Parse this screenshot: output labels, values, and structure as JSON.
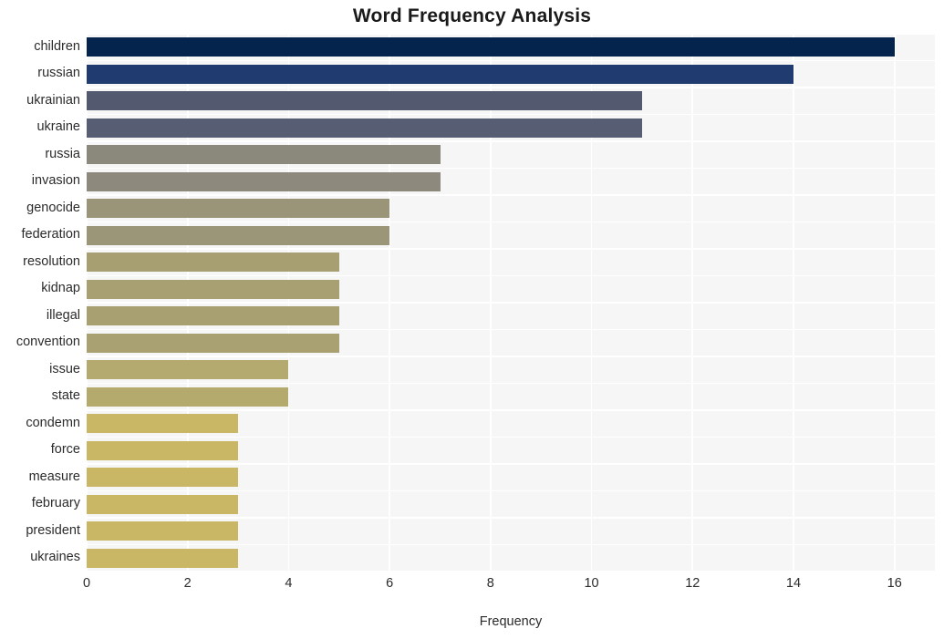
{
  "chart_data": {
    "type": "bar",
    "orientation": "horizontal",
    "title": "Word Frequency Analysis",
    "xlabel": "Frequency",
    "ylabel": "",
    "categories": [
      "children",
      "russian",
      "ukrainian",
      "ukraine",
      "russia",
      "invasion",
      "genocide",
      "federation",
      "resolution",
      "kidnap",
      "illegal",
      "convention",
      "issue",
      "state",
      "condemn",
      "force",
      "measure",
      "february",
      "president",
      "ukraines"
    ],
    "values": [
      16,
      14,
      11,
      11,
      7,
      7,
      6,
      6,
      5,
      5,
      5,
      5,
      4,
      4,
      3,
      3,
      3,
      3,
      3,
      3
    ],
    "bar_colors": [
      "#04244e",
      "#1f3b70",
      "#535a70",
      "#575d72",
      "#8b887c",
      "#8d8a7d",
      "#9a9478",
      "#9c9678",
      "#a79f72",
      "#a89f72",
      "#a9a072",
      "#aaa172",
      "#b4a96e",
      "#b5aa6e",
      "#c9b765",
      "#c9b765",
      "#c9b765",
      "#c9b765",
      "#c9b765",
      "#c9b765"
    ],
    "xlim": [
      0,
      16.8
    ],
    "xticks": [
      0,
      2,
      4,
      6,
      8,
      10,
      12,
      14,
      16
    ],
    "xtick_labels": [
      "0",
      "2",
      "4",
      "6",
      "8",
      "10",
      "12",
      "14",
      "16"
    ],
    "grid": true,
    "grid_axis": "both",
    "grid_color": "#ffffff",
    "legend": false,
    "plot_background": "#f6f6f7",
    "figure_background": "#ffffff",
    "text_color": "#2b2b2b",
    "title_color": "#1a1a1a"
  }
}
